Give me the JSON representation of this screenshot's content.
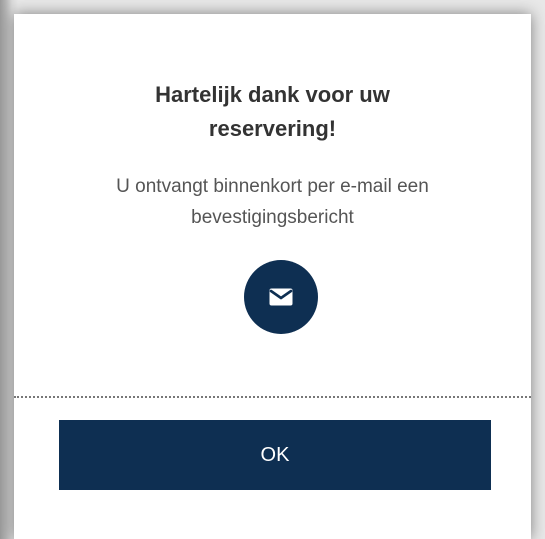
{
  "dialog": {
    "title_line1": "Hartelijk dank voor uw",
    "title_line2": "reservering!",
    "message_line1": "U ontvangt binnenkort per e-mail een",
    "message_line2": "bevestigingsbericht",
    "icon": "envelope-icon",
    "ok_label": "OK"
  },
  "colors": {
    "accent": "#0e2f52",
    "title_text": "#333333",
    "message_text": "#555555"
  }
}
